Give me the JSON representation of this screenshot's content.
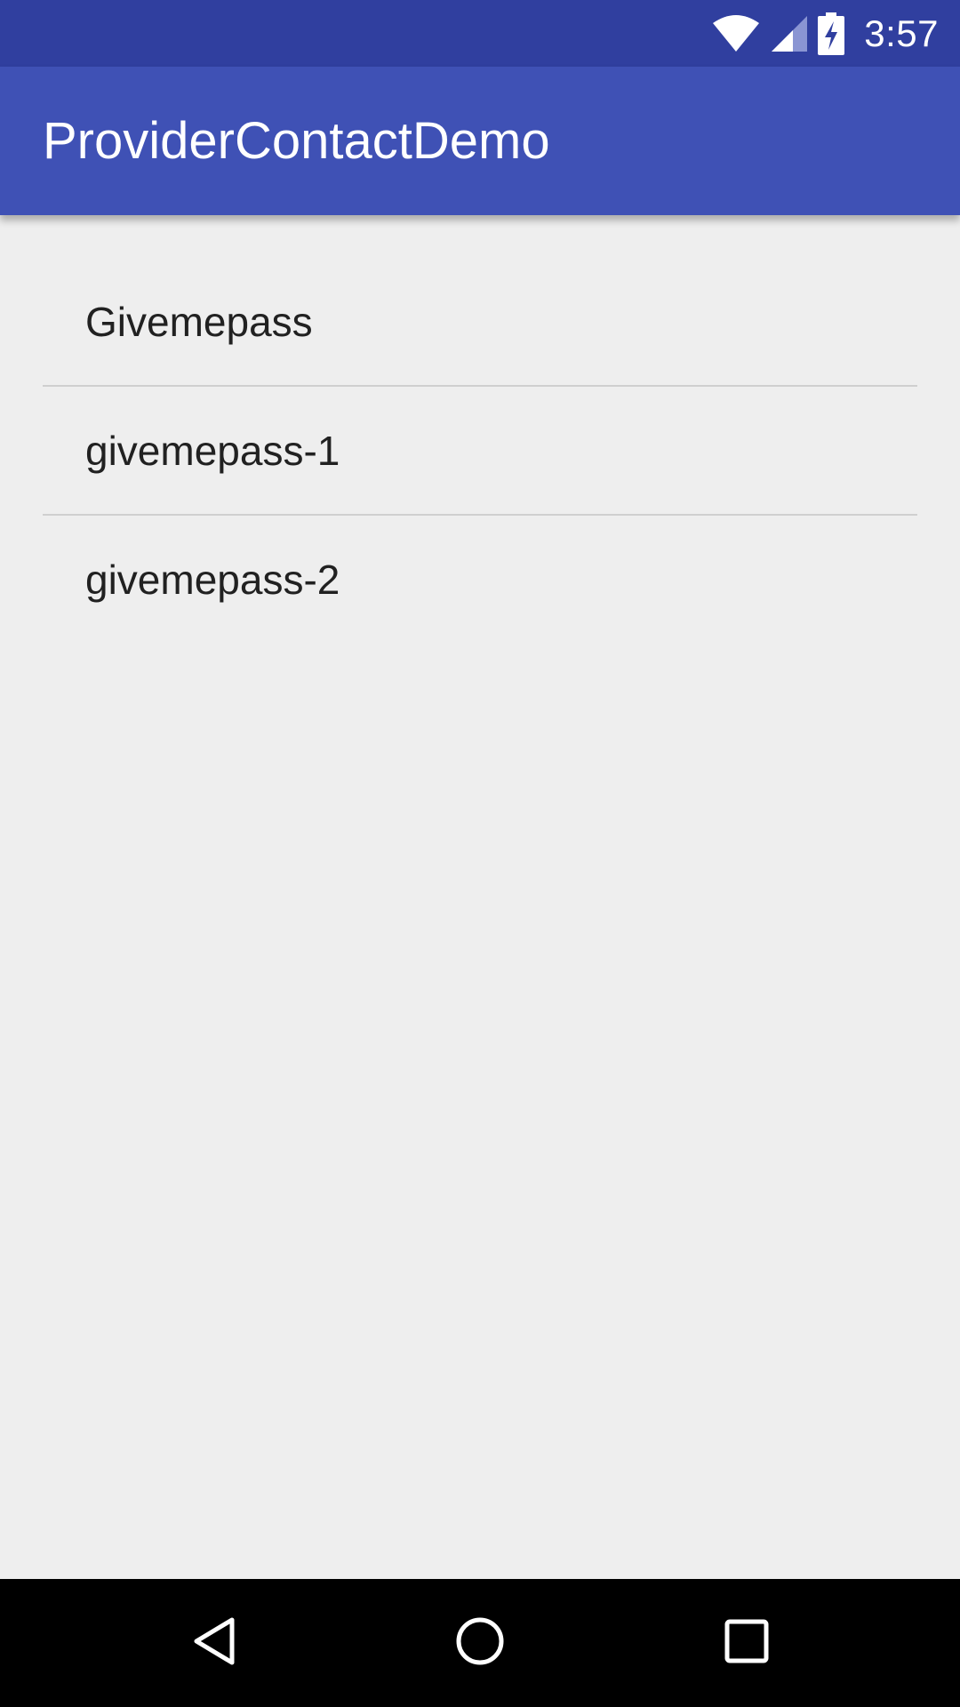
{
  "status_bar": {
    "time": "3:57",
    "icons": [
      "wifi-icon",
      "cell-signal-icon",
      "battery-charging-icon"
    ]
  },
  "app_bar": {
    "title": "ProviderContactDemo",
    "color": "#3f51b5"
  },
  "contacts": [
    {
      "name": "Givemepass"
    },
    {
      "name": "givemepass-1"
    },
    {
      "name": "givemepass-2"
    }
  ],
  "nav_bar": {
    "buttons": [
      "back-icon",
      "home-icon",
      "recents-icon"
    ]
  },
  "colors": {
    "status_bar": "#303f9f",
    "app_bar": "#3f51b5",
    "background": "#eeeeee",
    "divider": "#cfcfcf"
  }
}
